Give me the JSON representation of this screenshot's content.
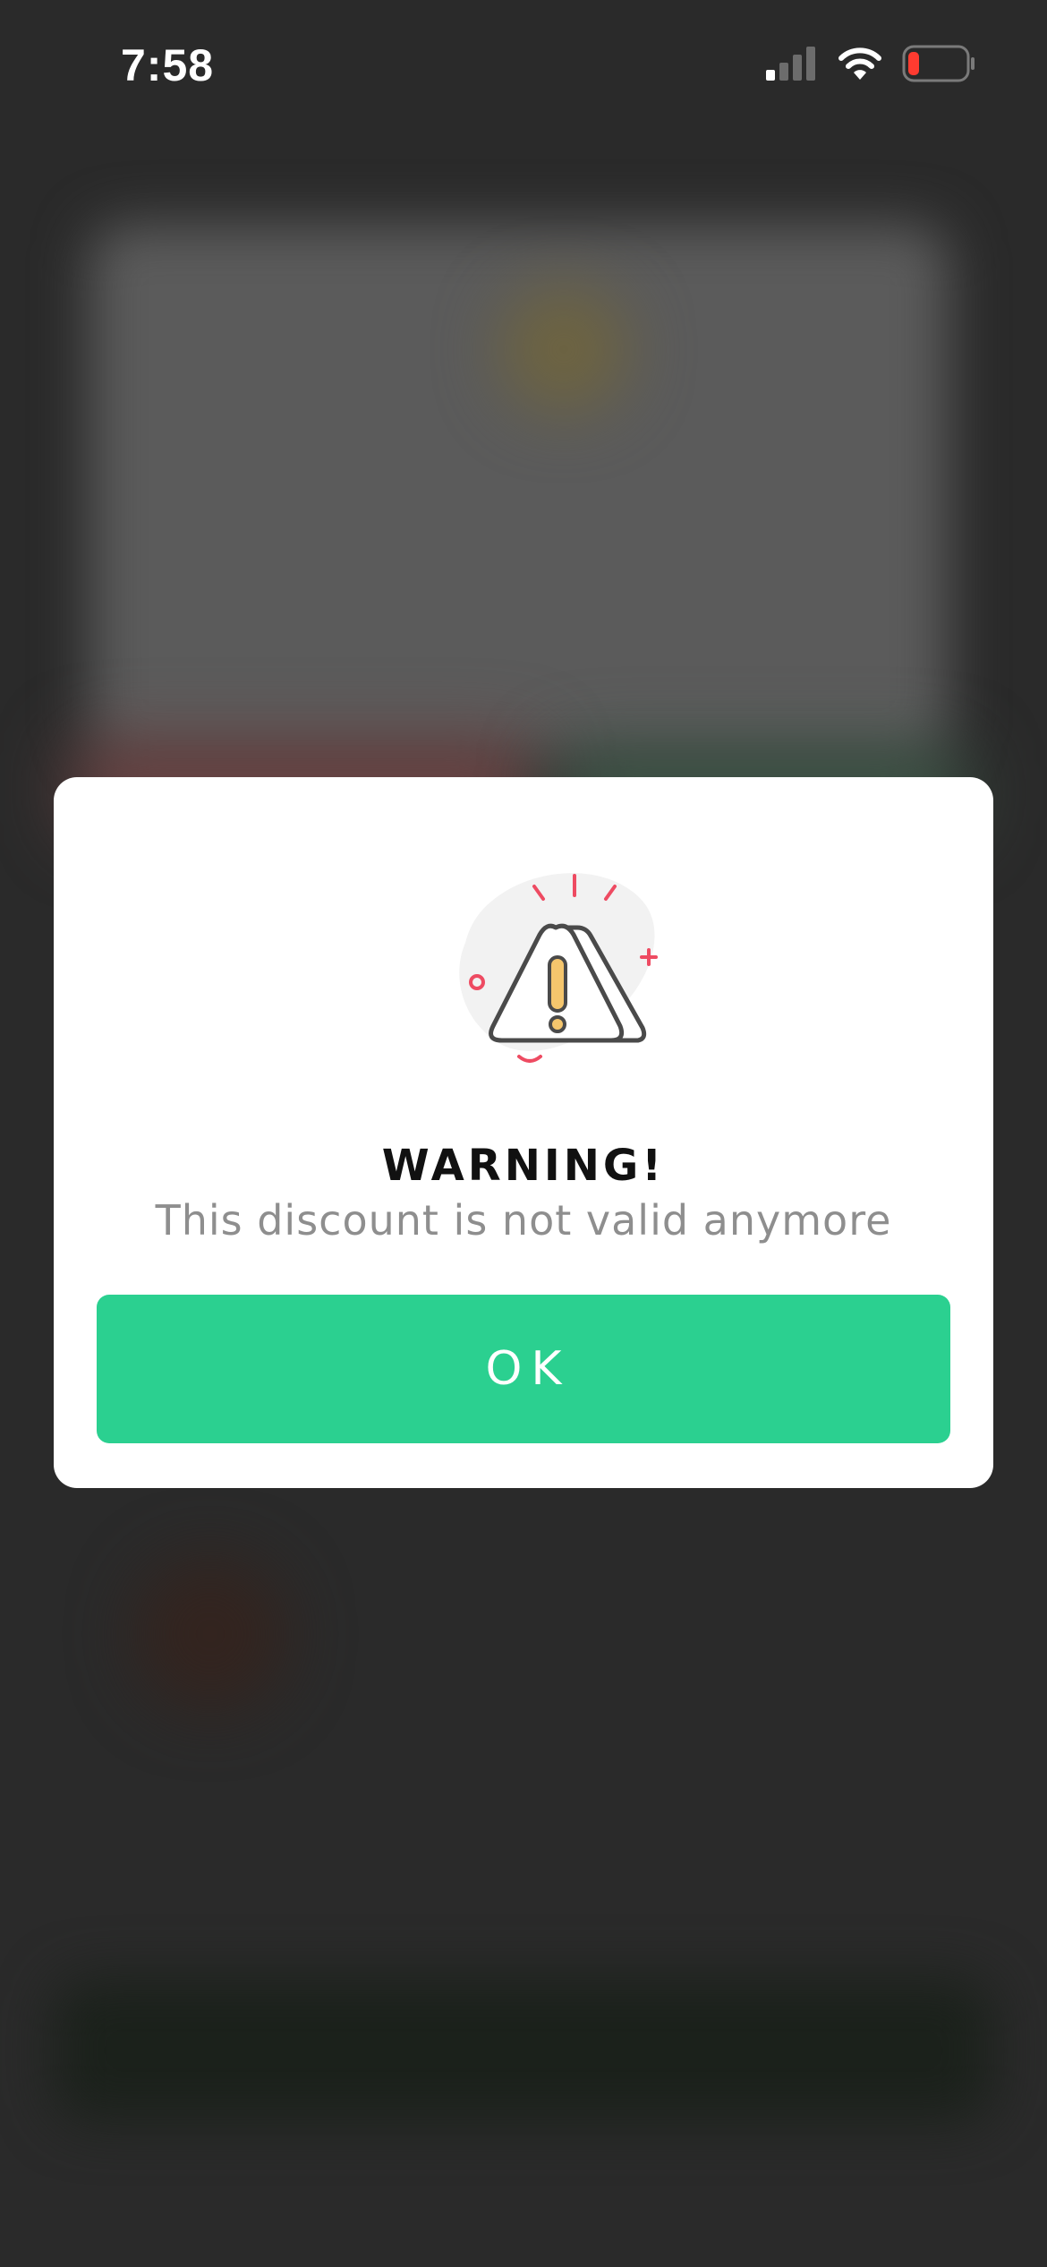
{
  "status_bar": {
    "time": "7:58",
    "icons": [
      "cellular-signal-icon",
      "wifi-icon",
      "battery-low-icon"
    ]
  },
  "modal": {
    "illustration_icon": "warning-triangle-icon",
    "title": "WARNING!",
    "message": "This discount is not valid anymore",
    "ok_label": "OK"
  },
  "colors": {
    "accent": "#2bd090",
    "warning_red": "#ee4b62",
    "warning_yellow": "#f5c66d",
    "overlay_background": "#2a2a2a",
    "battery_low": "#ff3b30"
  }
}
